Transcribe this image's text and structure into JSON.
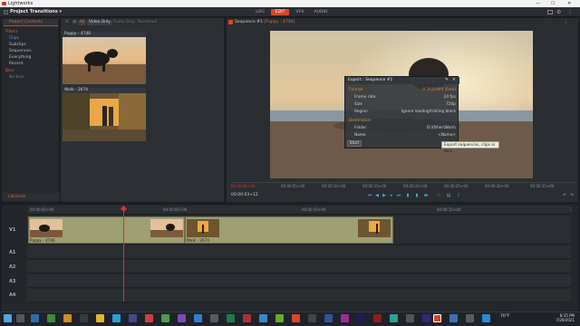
{
  "window": {
    "title": "Lightworks",
    "minimize": "—",
    "maximize": "☐",
    "close": "✕"
  },
  "menubar": {
    "project_label": "Project Transitions",
    "project_caret": "▾",
    "tabs": [
      {
        "label": "LOG",
        "active": false
      },
      {
        "label": "EDIT",
        "active": true
      },
      {
        "label": "VFX",
        "active": false
      },
      {
        "label": "AUDIO",
        "active": false
      }
    ]
  },
  "left_panel": {
    "header": "Project Contents",
    "items": [
      {
        "label": "Filters",
        "style": "header"
      },
      {
        "label": "Clips",
        "style": "selected"
      },
      {
        "label": "Subclips",
        "style": "normal"
      },
      {
        "label": "Sequences",
        "style": "normal"
      },
      {
        "label": "Everything",
        "style": "normal"
      },
      {
        "label": "Recent",
        "style": "normal"
      },
      {
        "label": "Bins",
        "style": "header"
      },
      {
        "label": "No bins",
        "style": "dim"
      }
    ],
    "libraries_label": "Libraries"
  },
  "bin_toolbar": {
    "all": "All",
    "video_only": "Video Only",
    "audio_only": "Audio Only",
    "rendered": "Rendered"
  },
  "clips": [
    {
      "title": "Puppy - 4746"
    },
    {
      "title": "Walk - 2674"
    }
  ],
  "viewer": {
    "title": "Sequence #1",
    "subtitle": "[Puppy - 4746]",
    "timecodes": [
      "00:00:00+00",
      "00:00:05+00",
      "00:00:10+00",
      "00:00:15+00",
      "00:00:20+00",
      "00:00:25+00",
      "00:00:30+00",
      "00:00:35+00"
    ],
    "current_tc": "00:00:03+12"
  },
  "export_dialog": {
    "title": "Export : Sequence #1",
    "format_label": "Format",
    "format_value": "H.264/MP4 (Free)",
    "frame_rate_label": "Frame rate",
    "frame_rate_value": "24 fps",
    "size_label": "Size",
    "size_value": "720p",
    "region_label": "Region",
    "region_value": "Ignore leading/trailing black",
    "destination_label": "Destination",
    "folder_label": "Folder",
    "folder_value": "D:\\Other\\Work\\",
    "name_label": "Name",
    "name_value": "<Name>",
    "start_label": "Start",
    "tooltip": "Export sequences, clips or bins"
  },
  "timeline": {
    "ruler": [
      "00:00:00+00",
      "00:00:05+00",
      "00:00:10+00",
      "00:00:15+00"
    ],
    "tracks": [
      "V1",
      "A1",
      "A2",
      "A3",
      "A4"
    ],
    "clip_labels": [
      "Puppy - 4746",
      "Walk - 2674"
    ]
  },
  "taskbar": {
    "temperature": "70°F",
    "time": "8:35 PM",
    "date": "7/29/2021"
  },
  "colors": {
    "accent": "#d9472b",
    "clip": "#9e9f72",
    "panel": "#2a2d32"
  }
}
